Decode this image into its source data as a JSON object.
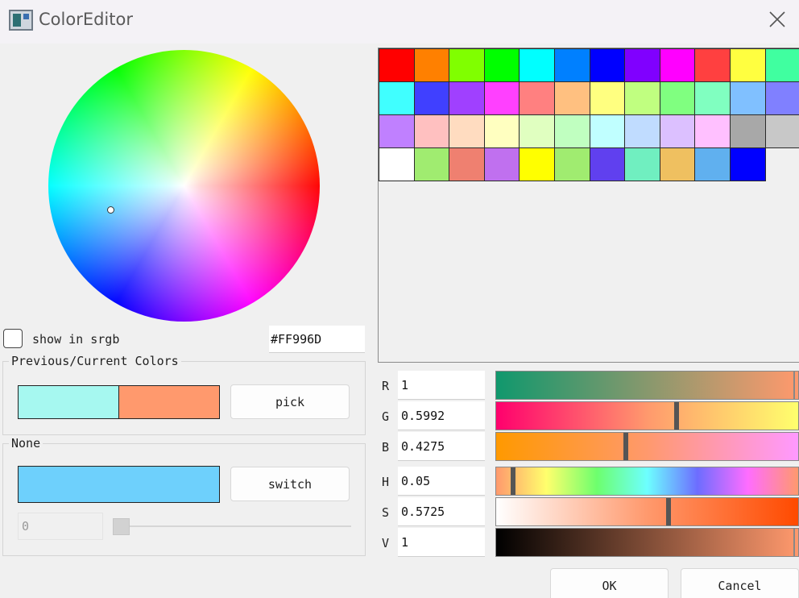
{
  "window": {
    "title": "ColorEditor"
  },
  "wheel": {
    "marker_hex": "#FF996D"
  },
  "srgb": {
    "label": "show in srgb",
    "checked": false
  },
  "hex_value": "#FF996D",
  "previous_current": {
    "title": "Previous/Current Colors",
    "previous_color": "#a6f8f0",
    "current_color": "#ff996d",
    "pick_label": "pick"
  },
  "none_group": {
    "title": "None",
    "color": "#6ed0fc",
    "switch_label": "switch",
    "alpha_value": "0",
    "alpha_level": 0
  },
  "palette": {
    "rows": [
      [
        "#ff0000",
        "#ff8000",
        "#80ff00",
        "#00ff00",
        "#00ffff",
        "#0080ff",
        "#0000ff",
        "#8000ff",
        "#ff00ff",
        "#ff4040",
        "#ffff40",
        "#40ffa0"
      ],
      [
        "#40ffff",
        "#4040ff",
        "#a040ff",
        "#ff40ff",
        "#ff8080",
        "#ffc080",
        "#ffff80",
        "#c0ff80",
        "#80ff80",
        "#80ffc0",
        "#80c0ff",
        "#8080ff"
      ],
      [
        "#c080ff",
        "#ffc0c0",
        "#ffdcc0",
        "#ffffc0",
        "#e0ffc0",
        "#c0ffc0",
        "#c0ffff",
        "#c0dcff",
        "#dcc0ff",
        "#ffc0ff",
        "#a8a8a8",
        "#c8c8c8"
      ],
      [
        "#ffffff",
        "#a0ec70",
        "#ef8070",
        "#c070ef",
        "#ffff00",
        "#a0ec70",
        "#6040ef",
        "#70efc0",
        "#efc060",
        "#60b0ef",
        "#0000ff"
      ]
    ]
  },
  "rgb": [
    {
      "label": "R",
      "value": "1",
      "level": 1.0,
      "gradient": "linear-gradient(to right, #10986d, #ff996d)"
    },
    {
      "label": "G",
      "value": "0.5992",
      "level": 0.5992,
      "gradient": "linear-gradient(to right, #ff006d, #ff996d, #ffff6d)"
    },
    {
      "label": "B",
      "value": "0.4275",
      "level": 0.4275,
      "gradient": "linear-gradient(to right, #ff9900, #ff996d, #ff99ff)"
    }
  ],
  "hsv": [
    {
      "label": "H",
      "value": "0.05",
      "level": 0.05,
      "gradient": "linear-gradient(to right, #ff996d, #ffff6d, #6dff6d, #6dffff, #6d6dff, #ff6dff, #ff996d)"
    },
    {
      "label": "S",
      "value": "0.5725",
      "level": 0.5725,
      "gradient": "linear-gradient(to right, #ffffff, #ff996d, #ff4a00)"
    },
    {
      "label": "V",
      "value": "1",
      "level": 1.0,
      "gradient": "linear-gradient(to right, #000000, #ff996d)"
    }
  ],
  "buttons": {
    "ok": "OK",
    "cancel": "Cancel"
  },
  "icons": {
    "app": "color-editor-app-icon",
    "close": "close-icon"
  }
}
